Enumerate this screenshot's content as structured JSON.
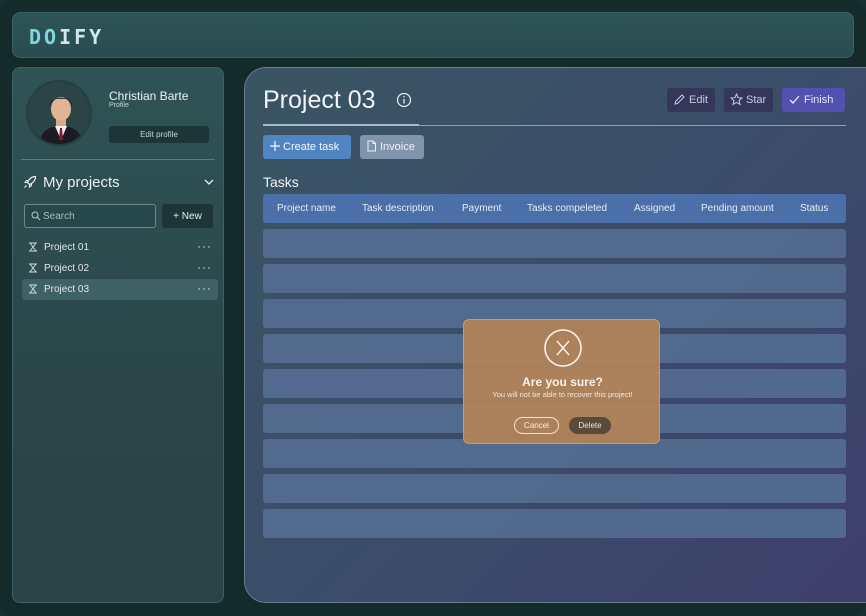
{
  "app": {
    "logo": "DOIFY"
  },
  "profile": {
    "name": "Christian Barte",
    "subtitle": "Profile",
    "edit_label": "Edit profile"
  },
  "projects": {
    "header": "My projects",
    "search_placeholder": "Search",
    "new_label": "New",
    "items": [
      {
        "label": "Project 01",
        "active": false
      },
      {
        "label": "Project 02",
        "active": false
      },
      {
        "label": "Project 03",
        "active": true
      }
    ]
  },
  "main": {
    "title": "Project 03",
    "actions": {
      "edit": "Edit",
      "star": "Star",
      "finish": "Finish"
    },
    "create_task": "Create task",
    "invoice": "Invoice",
    "tasks_label": "Tasks",
    "columns": [
      "Project name",
      "Task description",
      "Payment",
      "Tasks compeleted",
      "Assigned",
      "Pending amount",
      "Status"
    ]
  },
  "modal": {
    "title": "Are you sure?",
    "message": "You will not be able to recover this project!",
    "cancel": "Cancel",
    "delete": "Delete"
  },
  "colors": {
    "accent": "#4f86c2",
    "finish": "#5351b0",
    "modal": "#b38459"
  }
}
